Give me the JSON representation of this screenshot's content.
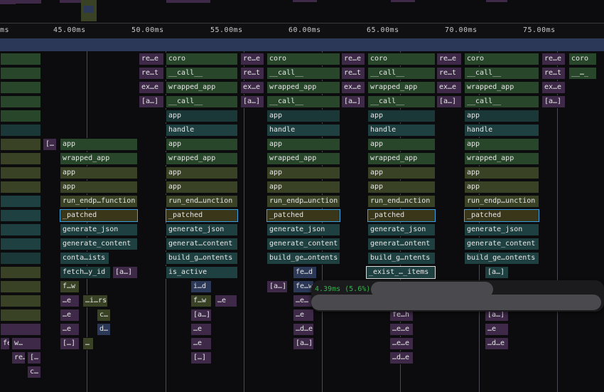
{
  "colors": {
    "green": "#27462a",
    "teal": "#1f4040",
    "darkteal": "#1b3838",
    "olive": "#3a4226",
    "gold": "#3a361a",
    "purple": "#3e2a48",
    "navy": "#2c3858",
    "selection_blue": "#3aa0e0",
    "tooltip_time": "#37b24d"
  },
  "ruler": {
    "ticks": [
      "45.00ms",
      "50.00ms",
      "55.00ms",
      "60.00ms",
      "65.00ms",
      "70.00ms",
      "75.00ms"
    ],
    "edge_tick": "ms"
  },
  "tooltip": {
    "duration": "4.39ms (5.6%)"
  },
  "frames": [
    "re…e",
    "re…t",
    "ex…e",
    "[a…]",
    "coro",
    "__call__",
    "wrapped_app",
    "__call__",
    "app",
    "handle",
    "app",
    "wrapped_app",
    "app",
    "app",
    "run_end…unction",
    "_patched",
    "generate_json",
    "generat…content",
    "build_g…ontents",
    "is_active",
    "re…e",
    "re…t",
    "ex…e",
    "[a…]",
    "coro",
    "__call__",
    "wrapped_app",
    "__call__",
    "app",
    "handle",
    "app",
    "wrapped_app",
    "app",
    "app",
    "run_endp…unction",
    "_patched",
    "generate_json",
    "generate_content",
    "build_ge…ontents",
    "re…e",
    "re…t",
    "ex…e",
    "[a…]",
    "coro",
    "__call__",
    "wrapped_app",
    "__call__",
    "app",
    "handle",
    "app",
    "wrapped_app",
    "app",
    "app",
    "run_end…nction",
    "_patched",
    "generate_json",
    "generat…ontent",
    "build_g…ntents",
    "_exist_…_items",
    "re…e",
    "re…t",
    "ex…e",
    "[a…]",
    "coro",
    "__call__",
    "wrapped_app",
    "__call__",
    "app",
    "handle",
    "app",
    "wrapped_app",
    "app",
    "app",
    "run_endp…unction",
    "_patched",
    "generate_json",
    "generate_content",
    "build_ge…ontents",
    "fe…s",
    "re…e",
    "re…t",
    "ex…e",
    "[a…]",
    "coro",
    "__…_",
    "[…",
    "app",
    "wrapped_app",
    "app",
    "app",
    "run_endp…function",
    "_patched",
    "generate_json",
    "generate_content",
    "conta…ists",
    "fetch…y_id",
    "[a…]",
    "f…w",
    "…e",
    "…e",
    "…e",
    "[…]",
    "…i…rs",
    "c…",
    "d…",
    "…",
    "i…d",
    "f…w",
    "[a…]",
    "…e",
    "…e",
    "…e",
    "[…]",
    "fe…d",
    "fe…w",
    "[a…]",
    "…e…",
    "…e",
    "…d…e",
    "[a…]",
    "fe…h",
    "…e…e",
    "…e…e",
    "…d…e",
    "[a…]",
    "…e",
    "…d…e",
    "[a…]",
    "fe…s",
    "w…",
    "re…th",
    "[…",
    "c…",
    "m…"
  ]
}
